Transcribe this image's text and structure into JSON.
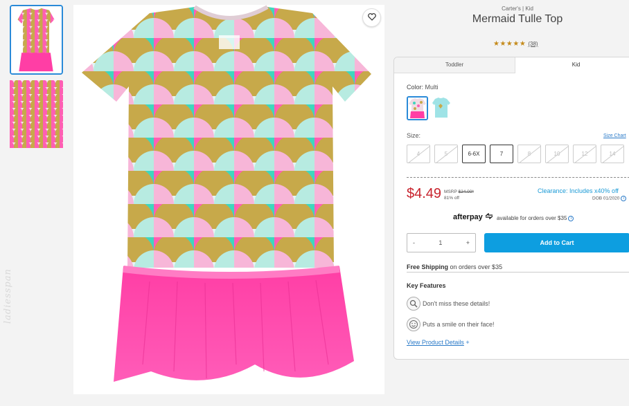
{
  "product": {
    "brand": "Carter's | Kid",
    "title": "Mermaid Tulle Top",
    "stars": "★★★★★",
    "review_count": "(38)",
    "rating": 5
  },
  "tabs": [
    {
      "label": "Toddler"
    },
    {
      "label": "Kid"
    }
  ],
  "color": {
    "label": "Color:",
    "value": "Multi"
  },
  "size": {
    "label": "Size:",
    "chart_link": "Size Chart",
    "options": [
      {
        "label": "4",
        "available": false
      },
      {
        "label": "5",
        "available": false
      },
      {
        "label": "6-6X",
        "available": true
      },
      {
        "label": "7",
        "available": true
      },
      {
        "label": "8",
        "available": false
      },
      {
        "label": "10",
        "available": false
      },
      {
        "label": "12",
        "available": false
      },
      {
        "label": "14",
        "available": false
      }
    ]
  },
  "pricing": {
    "price": "$4.49",
    "msrp_label": "MSRP",
    "msrp_value": "$24.00*",
    "discount": "81% off",
    "clearance": "Clearance: Includes x40% off",
    "dob": "DOB 01/2020"
  },
  "afterpay": {
    "logo": "afterpay",
    "note": "available for orders over $35"
  },
  "quantity": {
    "minus": "-",
    "value": "1",
    "plus": "+"
  },
  "cart": {
    "button_label": "Add to Cart"
  },
  "shipping": {
    "bold": "Free Shipping",
    "rest": "on orders over $35"
  },
  "features": {
    "title": "Key Features",
    "items": [
      {
        "text": "Don't miss these details!",
        "icon": "magnifier-icon"
      },
      {
        "text": "Puts a smile on their face!",
        "icon": "smile-icon"
      }
    ],
    "details_link": "View Product Details",
    "details_plus": "+"
  },
  "watermark": "ladiesspan",
  "colors": {
    "accent_blue": "#0d9ee0",
    "price_red": "#c8232d",
    "pink": "#ff3ea5",
    "teal": "#3fd6bd",
    "gold": "#c7a94a"
  }
}
